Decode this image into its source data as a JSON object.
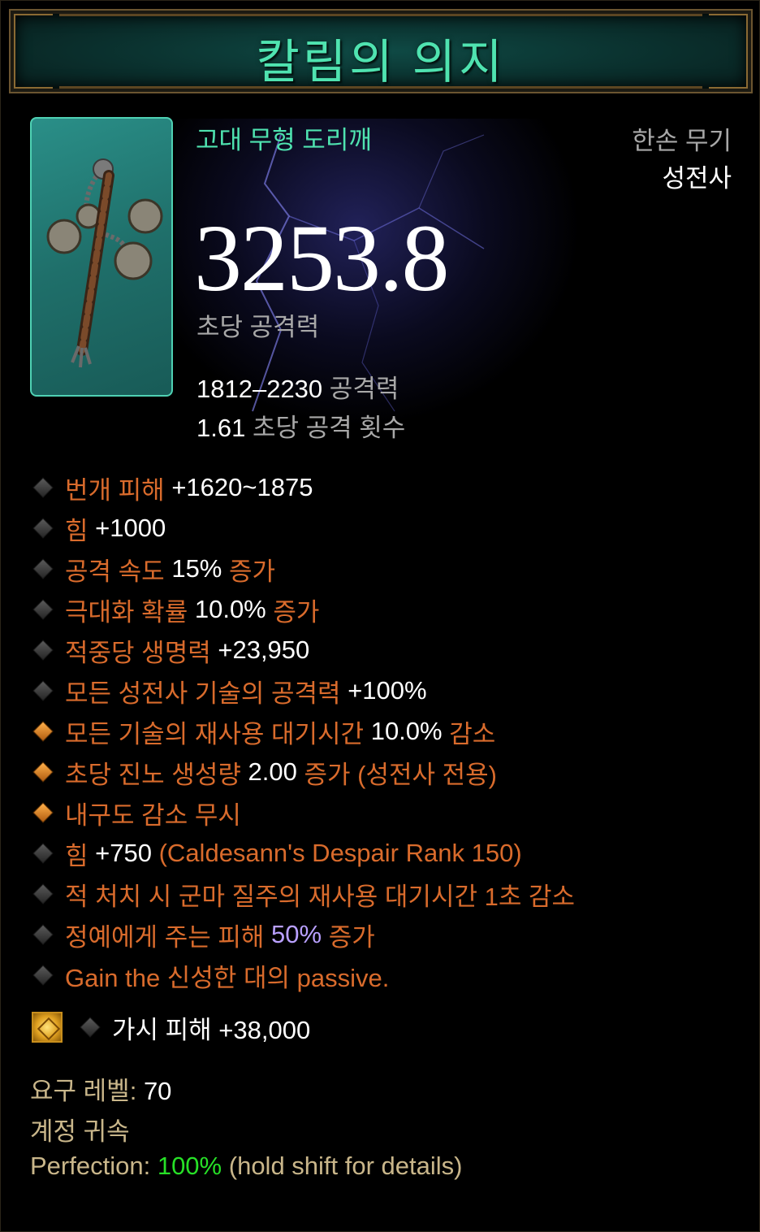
{
  "item": {
    "name": "칼림의 의지",
    "type": "고대 무형 도리깨",
    "slot": "한손 무기",
    "class": "성전사",
    "dps": "3253.8",
    "dps_label": "초당 공격력",
    "damage_range": "1812–2230",
    "damage_label": "공격력",
    "attack_speed": "1.61",
    "attack_speed_label": "초당 공격 횟수"
  },
  "affixes": [
    {
      "label": "번개 피해",
      "value": "+1620~1875",
      "bullet": "gray"
    },
    {
      "label": "힘",
      "value": "+1000",
      "bullet": "gray"
    },
    {
      "label": "공격 속도",
      "value": "15%",
      "suffix": "증가",
      "bullet": "gray"
    },
    {
      "label": "극대화 확률",
      "value": "10.0%",
      "suffix": "증가",
      "bullet": "gray"
    },
    {
      "label": "적중당 생명력",
      "value": "+23,950",
      "bullet": "gray"
    },
    {
      "label": "모든 성전사 기술의 공격력",
      "value": "+100%",
      "bullet": "gray"
    },
    {
      "label": "모든 기술의 재사용 대기시간",
      "value": "10.0%",
      "suffix": "감소",
      "bullet": "gold"
    },
    {
      "label": "초당 진노 생성량",
      "value": "2.00",
      "suffix": "증가 (성전사 전용)",
      "bullet": "gold"
    },
    {
      "label": "내구도 감소 무시",
      "bullet": "gold"
    },
    {
      "label": "힘",
      "value": "+750",
      "suffix": "(Caldesann's Despair Rank 150)",
      "bullet": "gray"
    },
    {
      "label": "적 처치 시 군마 질주의 재사용 대기시간 1초 감소",
      "bullet": "gray"
    },
    {
      "label": "정예에게 주는 피해",
      "value_purple": "50%",
      "suffix": "증가",
      "bullet": "gray"
    },
    {
      "label": "Gain the 신성한 대의 passive.",
      "bullet": "gray"
    }
  ],
  "socket": {
    "text": "가시 피해 +38,000",
    "gem_icon": "topaz-gem-icon"
  },
  "footer": {
    "req_label": "요구 레벨:",
    "req_value": "70",
    "bound": "계정 귀속",
    "perfection_label": "Perfection:",
    "perfection_value": "100%",
    "perfection_hint": "(hold shift for details)"
  },
  "colors": {
    "title": "#4fe3b0",
    "affix": "#d96b2c",
    "value": "#ffffff",
    "gray_text": "#a8a8a8",
    "perfection": "#27e027",
    "purple_value": "#b9a0ff"
  }
}
